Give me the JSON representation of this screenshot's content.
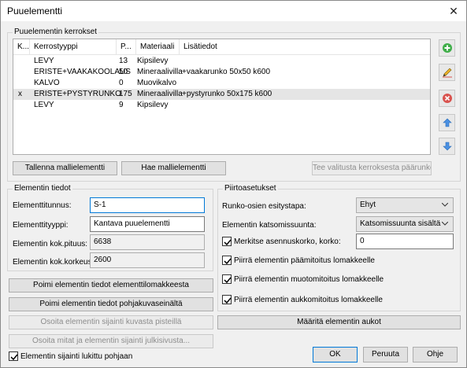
{
  "window": {
    "title": "Puuelementti",
    "close_glyph": "✕"
  },
  "layers": {
    "group_label": "Puuelementin kerrokset",
    "columns": [
      "K...",
      "Kerrostyyppi",
      "P...",
      "Materiaali",
      "Lisätiedot"
    ],
    "rows": [
      {
        "k": "",
        "type": "LEVY",
        "p": "13",
        "material": "Kipsilevy",
        "extra": "",
        "selected": false
      },
      {
        "k": "",
        "type": "ERISTE+VAAKAKOOLAUS",
        "p": "50",
        "material": "Mineraalivilla",
        "extra": "+vaakarunko 50x50 k600",
        "selected": false
      },
      {
        "k": "",
        "type": "KALVO",
        "p": "0",
        "material": "Muovikalvo",
        "extra": "",
        "selected": false
      },
      {
        "k": "x",
        "type": "ERISTE+PYSTYRUNKO",
        "p": "175",
        "material": "Mineraalivilla",
        "extra": "+pystyrunko 50x175 k600",
        "selected": true
      },
      {
        "k": "",
        "type": "LEVY",
        "p": "9",
        "material": "Kipsilevy",
        "extra": "",
        "selected": false
      }
    ],
    "save_template": "Tallenna mallielementti",
    "load_template": "Hae mallielementti",
    "make_main_frame": "Tee valitusta kerroksesta päärunko"
  },
  "side_buttons": [
    "add-icon",
    "edit-icon",
    "delete-icon",
    "move-up-icon",
    "move-down-icon"
  ],
  "element_info": {
    "group_label": "Elementin tiedot",
    "id_label": "Elementtitunnus:",
    "id_value": "S-1",
    "type_label": "Elementtityyppi:",
    "type_value": "Kantava puuelementti",
    "length_label": "Elementin kok.pituus:",
    "length_value": "6638",
    "height_label": "Elementin kok.korkeus:",
    "height_value": "2600"
  },
  "left_buttons": {
    "pick_from_form": "Poimi elementin tiedot elementtilomakkeesta",
    "pick_from_plan": "Poimi elementin tiedot pohjakuvaseinältä",
    "locate_by_point": "Osoita elementin sijainti kuvasta pisteillä",
    "locate_from_facade": "Osoita mitat ja elementin sijainti julkisivusta..."
  },
  "lock_checkbox": {
    "label": "Elementin sijainti lukittu pohjaan",
    "checked": true
  },
  "draw_settings": {
    "group_label": "Piirtoasetukset",
    "frame_label": "Runko-osien esitystapa:",
    "frame_value": "Ehyt",
    "view_label": "Elementin katsomissuunta:",
    "view_value": "Katsomissuunta sisältä",
    "mark_label": "Merkitse asennuskorko, korko:",
    "mark_checked": true,
    "mark_value": "0",
    "cb1": {
      "label": "Piirrä elementin päämitoitus lomakkeelle",
      "checked": true
    },
    "cb2": {
      "label": "Piirrä elementin muotomitoitus lomakkeelle",
      "checked": true
    },
    "cb3": {
      "label": "Piirrä elementin aukkomitoitus lomakkeelle",
      "checked": true
    },
    "openings_button": "Määritä elementin aukot"
  },
  "footer": {
    "ok": "OK",
    "cancel": "Peruuta",
    "help": "Ohje"
  },
  "colors": {
    "add": "#3fae49",
    "delete": "#d9534f",
    "arrows": "#4a90e2",
    "focus": "#0078d7"
  }
}
